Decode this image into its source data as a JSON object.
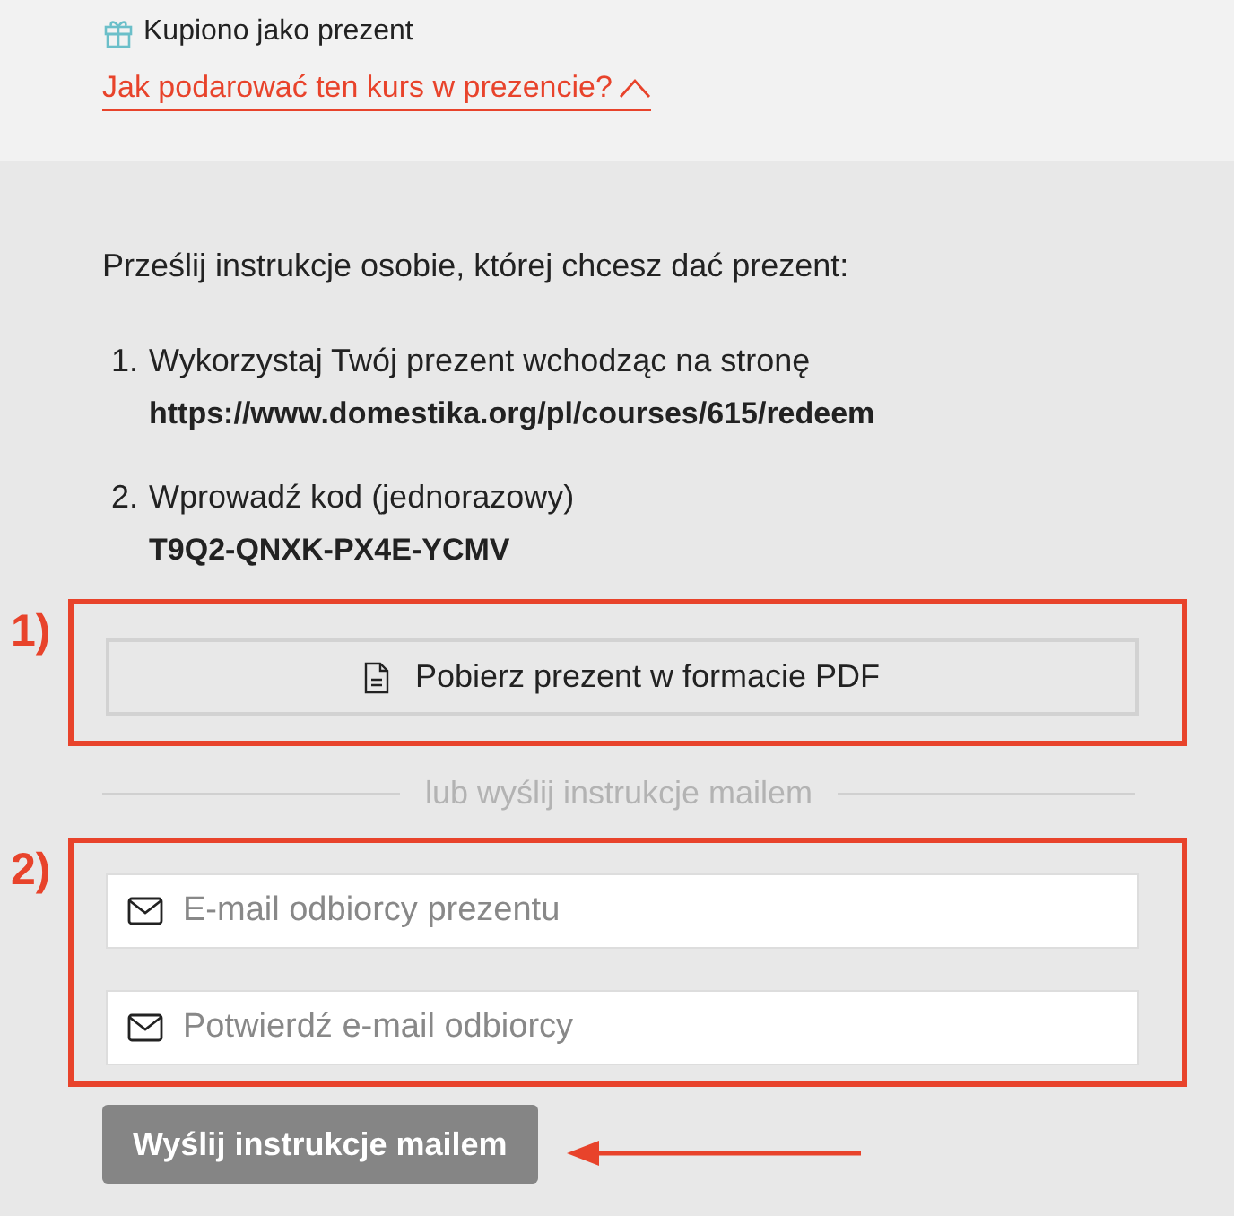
{
  "gift_status": {
    "label": "Kupiono jako prezent"
  },
  "gift_link": {
    "label": "Jak podarować ten kurs w prezencie?",
    "expanded": true
  },
  "instruction": "Prześlij instrukcje osobie, której chcesz dać prezent:",
  "steps": [
    {
      "number": "1.",
      "text": "Wykorzystaj Twój prezent wchodząc na stronę",
      "value": "https://www.domestika.org/pl/courses/615/redeem"
    },
    {
      "number": "2.",
      "text": "Wprowadź kod (jednorazowy)",
      "value": "T9Q2-QNXK-PX4E-YCMV"
    }
  ],
  "pdf_button": {
    "label": "Pobierz prezent w formacie PDF",
    "annotation": "1)"
  },
  "divider": "lub wyślij instrukcje mailem",
  "email_fields": {
    "annotation": "2)",
    "fields": [
      {
        "placeholder": "E-mail odbiorcy prezentu"
      },
      {
        "placeholder": "Potwierdź e-mail odbiorcy"
      }
    ]
  },
  "send_button": {
    "label": "Wyślij instrukcje mailem",
    "disabled": true
  }
}
